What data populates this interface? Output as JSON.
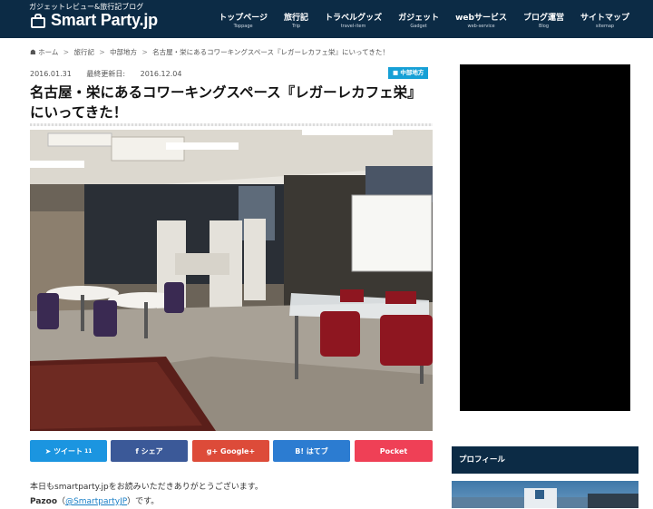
{
  "header": {
    "tagline": "ガジェットレビュー&旅行記ブログ",
    "site_name": "Smart Party.jp",
    "nav": [
      {
        "jp": "トップページ",
        "en": "Toppage"
      },
      {
        "jp": "旅行記",
        "en": "Trip"
      },
      {
        "jp": "トラベルグッズ",
        "en": "travel-item"
      },
      {
        "jp": "ガジェット",
        "en": "Gadget"
      },
      {
        "jp": "webサービス",
        "en": "web-service"
      },
      {
        "jp": "ブログ運営",
        "en": "Blog"
      },
      {
        "jp": "サイトマップ",
        "en": "sitemap"
      }
    ]
  },
  "breadcrumb": {
    "home": "ホーム",
    "items": [
      "旅行記",
      "中部地方",
      "名古屋・栄にあるコワーキングスペース『レガーレカフェ栄』にいってきた！"
    ]
  },
  "article": {
    "date": "2016.01.31",
    "updated_label": "最終更新日:",
    "updated": "2016.12.04",
    "category": "中部地方",
    "title": "名古屋・栄にあるコワーキングスペース『レガーレカフェ栄』にいってきた！"
  },
  "share": [
    {
      "label": "ツイート",
      "count": "11",
      "color": "#1b95e0"
    },
    {
      "label": "シェア",
      "count": "",
      "color": "#3b5998"
    },
    {
      "label": "Google+",
      "count": "",
      "color": "#dd4b39"
    },
    {
      "label": "はてブ",
      "count": "",
      "color": "#2c7cd1"
    },
    {
      "label": "Pocket",
      "count": "",
      "color": "#ef4056"
    }
  ],
  "intro": {
    "line1": "本日もsmartparty.jpをお読みいただきありがとうございます。",
    "line2_name": "Pazoo",
    "line2_handle": "@SmartpartyJP",
    "line2_suffix": "です。"
  },
  "sidebar": {
    "profile_heading": "プロフィール"
  }
}
